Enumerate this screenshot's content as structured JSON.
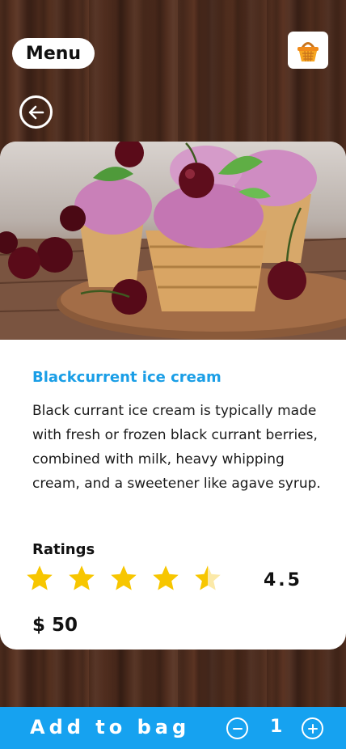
{
  "header": {
    "menu_label": "Menu",
    "basket_icon": "basket-icon",
    "back_icon": "back-arrow-icon"
  },
  "product": {
    "image_icon": "ice-cream-photo",
    "title": "Blackcurrent ice cream",
    "description": "Black currant ice cream is typically made with fresh or frozen black currant berries, combined with milk, heavy whipping cream, and a sweetener like agave syrup.",
    "ratings_label": "Ratings",
    "rating_value": "4.5",
    "rating": 4.5,
    "rating_max": 5,
    "price": "$ 50"
  },
  "bottom_bar": {
    "add_label": "Add to bag",
    "quantity": "1",
    "minus_icon": "minus-circle-icon",
    "plus_icon": "plus-circle-icon"
  },
  "colors": {
    "accent": "#16a2f0",
    "title": "#1a9ee6",
    "star": "#f7c600"
  }
}
